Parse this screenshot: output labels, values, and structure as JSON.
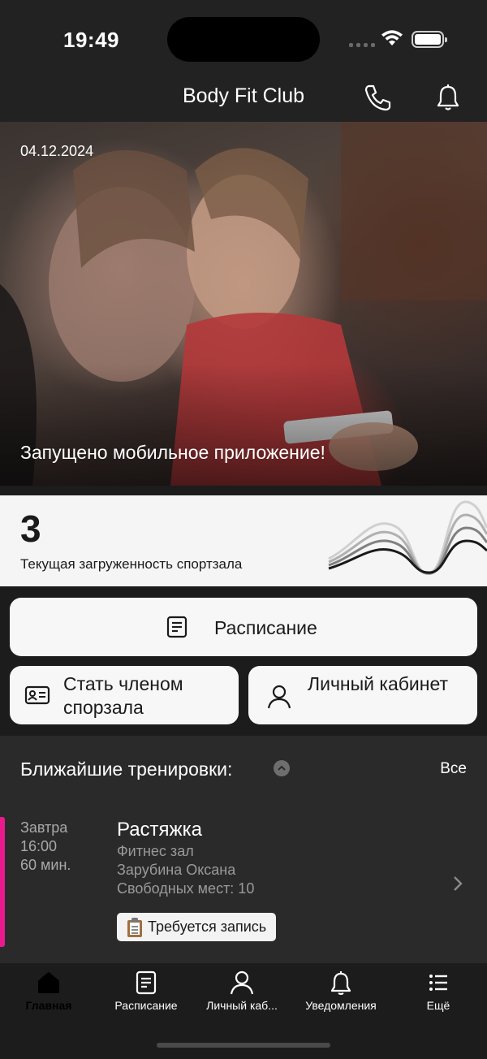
{
  "status_bar": {
    "time": "19:49"
  },
  "header": {
    "title": "Body Fit Club",
    "icons": [
      "phone-icon",
      "bell-icon"
    ]
  },
  "hero": {
    "date": "04.12.2024",
    "caption": "Запущено мобильное приложение!"
  },
  "gym_load": {
    "value": "3",
    "label": "Текущая загруженность спортзала"
  },
  "actions": {
    "schedule": "Расписание",
    "membership": "Стать членом спорзала",
    "account": "Личный кабинет"
  },
  "upcoming": {
    "title": "Ближайшие тренировки:",
    "all_link": "Все",
    "items": [
      {
        "day": "Завтра",
        "time": "16:00",
        "duration": "60 мин.",
        "name": "Растяжка",
        "location": "Фитнес зал",
        "trainer": "Зарубина Оксана",
        "seats": "Свободных мест: 10",
        "badge": "Требуется запись",
        "accent_color": "#ea1a8e"
      }
    ]
  },
  "tabbar": {
    "items": [
      {
        "label": "Главная",
        "icon": "home-icon",
        "active": true
      },
      {
        "label": "Расписание",
        "icon": "document-icon",
        "active": false
      },
      {
        "label": "Личный каб...",
        "icon": "person-icon",
        "active": false
      },
      {
        "label": "Уведомления",
        "icon": "bell-icon",
        "active": false
      },
      {
        "label": "Ещё",
        "icon": "list-icon",
        "active": false
      }
    ]
  }
}
